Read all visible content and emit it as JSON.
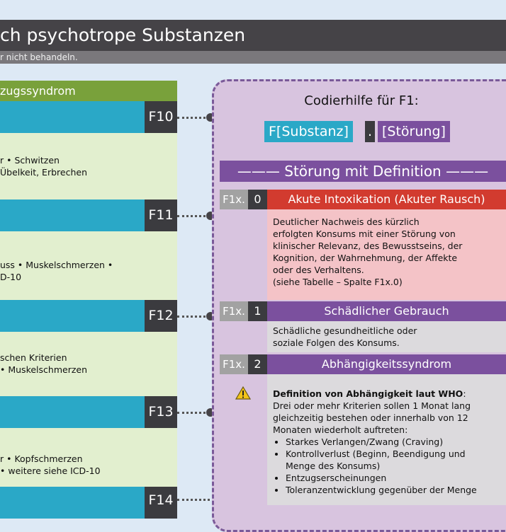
{
  "header": {
    "title": "ch psychotrope Substanzen",
    "subtitle": "r nicht behandeln."
  },
  "left_column": {
    "heading": "zugssyndrom",
    "rows": [
      {
        "code": "F10",
        "lines": [
          "r • Schwitzen",
          "Übelkeit, Erbrechen"
        ]
      },
      {
        "code": "F11",
        "lines": [
          "uss • Muskelschmerzen •",
          "D-10"
        ]
      },
      {
        "code": "F12",
        "lines": [
          "schen Kriterien",
          "• Muskelschmerzen"
        ]
      },
      {
        "code": "F13",
        "lines": [
          "r • Kopfschmerzen",
          "• weitere siehe ICD-10"
        ]
      },
      {
        "code": "F14",
        "lines": []
      }
    ]
  },
  "codierhilfe": {
    "title": "Codierhilfe für F1:",
    "chip_substanz": "F[Substanz]",
    "chip_dot": ".",
    "chip_stoerung": "[Störung]"
  },
  "definitions": {
    "heading": "——— Störung mit Definition ———",
    "items": [
      {
        "prefix": "F1x.",
        "number": "0",
        "title": "Akute Intoxikation (Akuter Rausch)",
        "lines": [
          "Deutlicher Nachweis des kürzlich",
          "erfolgten Konsums mit einer Störung von",
          "klinischer Relevanz, des Bewusstseins, der",
          "Kognition, der Wahrnehmung, der Affekte",
          "oder des Verhaltens.",
          "(siehe Tabelle – Spalte F1x.0)"
        ]
      },
      {
        "prefix": "F1x.",
        "number": "1",
        "title": "Schädlicher Gebrauch",
        "lines": [
          "Schädliche gesundheitliche oder",
          "soziale Folgen des Konsums."
        ]
      },
      {
        "prefix": "F1x.",
        "number": "2",
        "title": "Abhängigkeitssyndrom",
        "warning_icon": "warning-triangle-icon",
        "bold_line": "Definition von Abhängigkeit laut WHO",
        "bold_suffix": ":",
        "lines": [
          "Drei oder mehr Kriterien sollen 1 Monat lang",
          "gleichzeitig bestehen oder innerhalb von 12",
          "Monaten wiederholt auftreten:"
        ],
        "criteria": [
          "Starkes Verlangen/Zwang (Craving)",
          "Kontrollverlust (Beginn, Beendigung und\nMenge des Konsums)",
          "Entzugserscheinungen",
          "Toleranzentwicklung gegenüber der Menge"
        ]
      }
    ]
  },
  "colors": {
    "title_bar": "#454347",
    "green": "#79a13b",
    "teal": "#2aa8c7",
    "dark_code": "#3b3b3f",
    "purple": "#7b509e",
    "red": "#d23b2f",
    "pink": "#f4c3c7",
    "light_grey": "#dcdadd",
    "panel": "#d8c4df"
  }
}
